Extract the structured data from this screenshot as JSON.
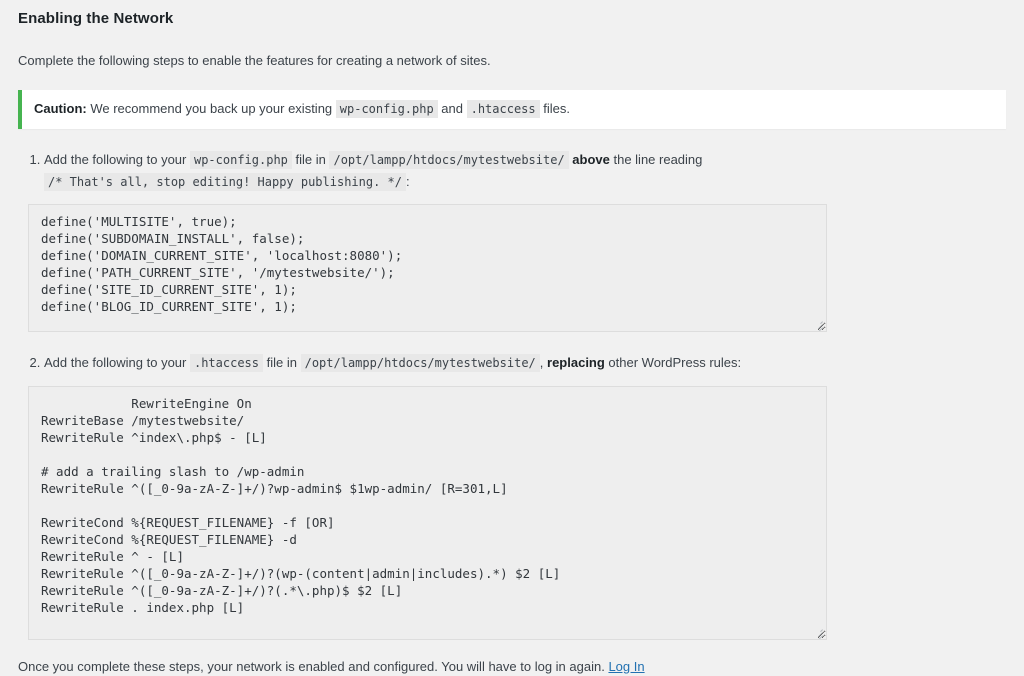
{
  "page": {
    "title": "Enabling the Network",
    "intro": "Complete the following steps to enable the features for creating a network of sites.",
    "outro_text": "Once you complete these steps, your network is enabled and configured. You will have to log in again.",
    "login_link_label": "Log In"
  },
  "notice": {
    "label": "Caution:",
    "text_before_code1": " We recommend you back up your existing ",
    "code1": "wp-config.php",
    "text_between": " and ",
    "code2": ".htaccess",
    "text_after": " files.",
    "accent_color": "#46b450",
    "background_color": "#ffffff"
  },
  "steps": [
    {
      "text_1": "Add the following to your ",
      "code_file": "wp-config.php",
      "text_2": " file in ",
      "code_path": "/opt/lampp/htdocs/mytestwebsite/",
      "text_3": " ",
      "emphasis": "above",
      "text_4": " the line reading ",
      "code_marker": "/* That's all, stop editing! Happy publishing. */",
      "text_5": ":",
      "code_block": "define('MULTISITE', true);\ndefine('SUBDOMAIN_INSTALL', false);\ndefine('DOMAIN_CURRENT_SITE', 'localhost:8080');\ndefine('PATH_CURRENT_SITE', '/mytestwebsite/');\ndefine('SITE_ID_CURRENT_SITE', 1);\ndefine('BLOG_ID_CURRENT_SITE', 1);"
    },
    {
      "text_1": "Add the following to your ",
      "code_file": ".htaccess",
      "text_2": " file in ",
      "code_path": "/opt/lampp/htdocs/mytestwebsite/",
      "text_3": ", ",
      "emphasis": "replacing",
      "text_4": " other WordPress rules:",
      "code_block": "            RewriteEngine On\nRewriteBase /mytestwebsite/\nRewriteRule ^index\\.php$ - [L]\n\n# add a trailing slash to /wp-admin\nRewriteRule ^([_0-9a-zA-Z-]+/)?wp-admin$ $1wp-admin/ [R=301,L]\n\nRewriteCond %{REQUEST_FILENAME} -f [OR]\nRewriteCond %{REQUEST_FILENAME} -d\nRewriteRule ^ - [L]\nRewriteRule ^([_0-9a-zA-Z-]+/)?(wp-(content|admin|includes).*) $2 [L]\nRewriteRule ^([_0-9a-zA-Z-]+/)?(.*\\.php)$ $2 [L]\nRewriteRule . index.php [L]"
    }
  ],
  "colors": {
    "page_background": "#f1f1f1",
    "code_chip_background": "#e8e8e8",
    "textarea_background": "#eeeeee",
    "link": "#2271b1"
  }
}
